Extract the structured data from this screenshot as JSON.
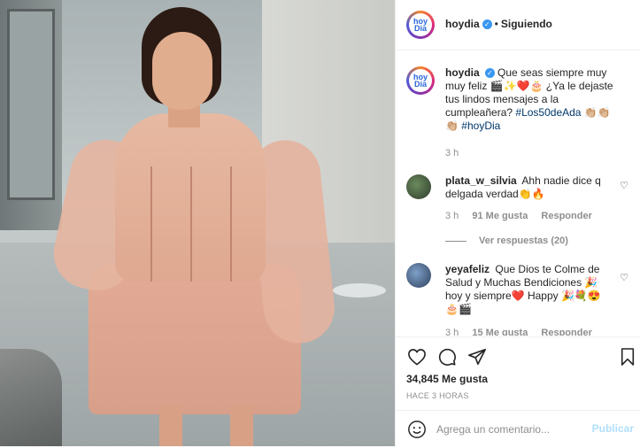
{
  "post": {
    "account": "hoydia",
    "avatar_text_line1": "hoy",
    "avatar_text_line2": "Día",
    "follow_status": "Siguiendo",
    "caption_text": "Que seas siempre muy muy feliz 🎬✨❤️🎂 ¿Ya le dejaste tus lindos mensajes a la cumpleañera?",
    "caption_tag1": "#Los50deAda",
    "caption_emoji": "👏🏼👏🏼👏🏼",
    "caption_tag2": "#hoyDia",
    "caption_time": "3 h",
    "likes": "34,845 Me gusta",
    "posted_ago": "HACE 3 HORAS"
  },
  "comments": [
    {
      "username": "plata_w_silvia",
      "text": "Ahh nadie dice q delgada verdad👏🔥",
      "time": "3 h",
      "likes": "91 Me gusta",
      "reply_label": "Responder",
      "view_replies": "Ver respuestas (20)"
    },
    {
      "username": "yeyafeliz",
      "text": "Que Dios te Colme de Salud y Muchas Bendiciones 🎉 hoy y siempre❤️ Happy 🎉💐😍🎂🎬",
      "time": "3 h",
      "likes": "15 Me gusta",
      "reply_label": "Responder"
    }
  ],
  "add_comment": {
    "placeholder": "Agrega un comentario...",
    "publish_label": "Publicar"
  },
  "icons": {
    "like": "heart-outline-icon",
    "comment": "speech-bubble-icon",
    "share": "paper-plane-icon",
    "save": "bookmark-icon",
    "emoji": "smiley-icon",
    "verified": "verified-badge-icon"
  },
  "colors": {
    "verified": "#3897f0",
    "link": "#00376b",
    "muted": "#8e8e8e",
    "publish_disabled": "#b2dffc"
  }
}
